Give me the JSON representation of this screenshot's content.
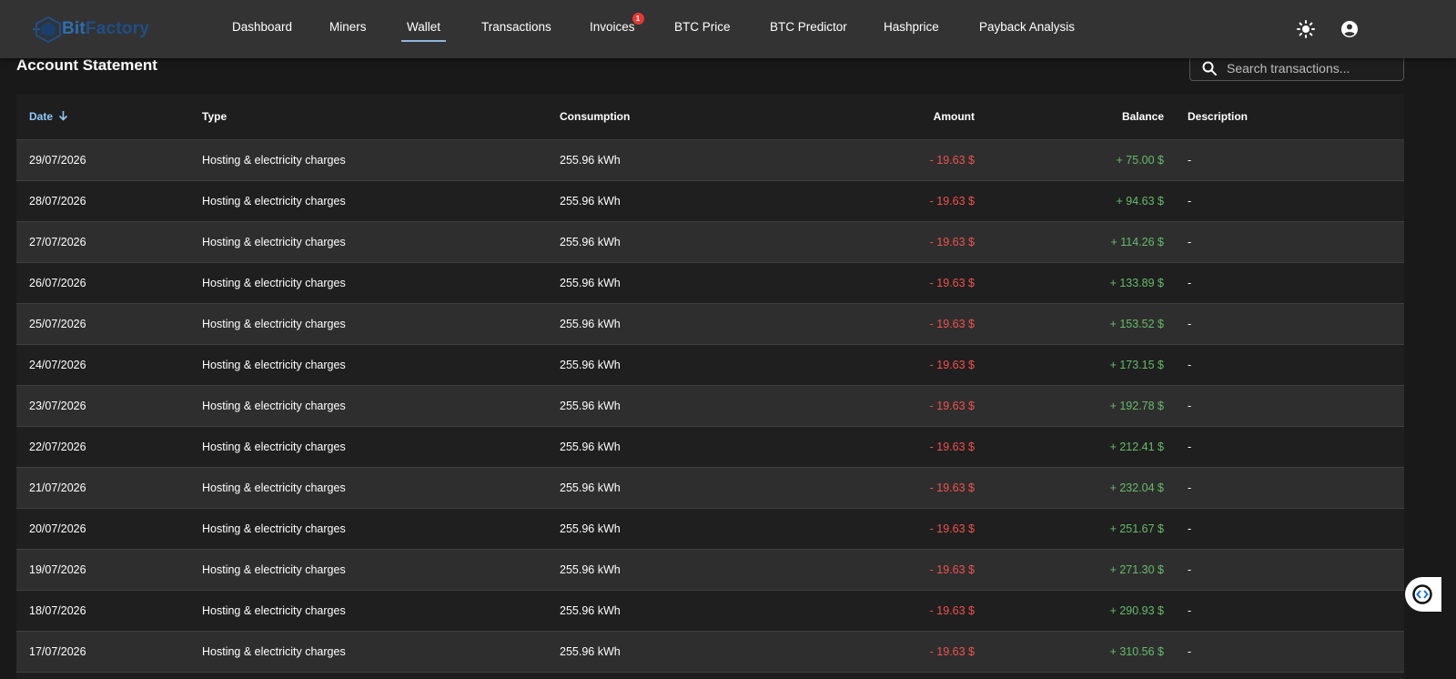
{
  "app": {
    "logo_text_a": "Bit",
    "logo_text_b": "Factory"
  },
  "nav": {
    "items": [
      {
        "label": "Dashboard"
      },
      {
        "label": "Miners"
      },
      {
        "label": "Wallet"
      },
      {
        "label": "Transactions"
      },
      {
        "label": "Invoices",
        "badge": "1"
      },
      {
        "label": "BTC Price"
      },
      {
        "label": "BTC Predictor"
      },
      {
        "label": "Hashprice"
      },
      {
        "label": "Payback Analysis"
      }
    ],
    "active": "Wallet",
    "icons": [
      "theme-toggle-sun-icon",
      "account-circle-icon"
    ]
  },
  "page": {
    "title": "Account Statement",
    "search_placeholder": "Search transactions..."
  },
  "table": {
    "columns": [
      "Date",
      "Type",
      "Consumption",
      "Amount",
      "Balance",
      "Description"
    ],
    "sort_column": "Date",
    "sort_direction": "descending",
    "rows": [
      {
        "date": "29/07/2026",
        "type": "Hosting & electricity charges",
        "consumption": "255.96 kWh",
        "amount": "- 19.63 $",
        "balance": "+ 75.00 $",
        "description": "-"
      },
      {
        "date": "28/07/2026",
        "type": "Hosting & electricity charges",
        "consumption": "255.96 kWh",
        "amount": "- 19.63 $",
        "balance": "+ 94.63 $",
        "description": "-"
      },
      {
        "date": "27/07/2026",
        "type": "Hosting & electricity charges",
        "consumption": "255.96 kWh",
        "amount": "- 19.63 $",
        "balance": "+ 114.26 $",
        "description": "-"
      },
      {
        "date": "26/07/2026",
        "type": "Hosting & electricity charges",
        "consumption": "255.96 kWh",
        "amount": "- 19.63 $",
        "balance": "+ 133.89 $",
        "description": "-"
      },
      {
        "date": "25/07/2026",
        "type": "Hosting & electricity charges",
        "consumption": "255.96 kWh",
        "amount": "- 19.63 $",
        "balance": "+ 153.52 $",
        "description": "-"
      },
      {
        "date": "24/07/2026",
        "type": "Hosting & electricity charges",
        "consumption": "255.96 kWh",
        "amount": "- 19.63 $",
        "balance": "+ 173.15 $",
        "description": "-"
      },
      {
        "date": "23/07/2026",
        "type": "Hosting & electricity charges",
        "consumption": "255.96 kWh",
        "amount": "- 19.63 $",
        "balance": "+ 192.78 $",
        "description": "-"
      },
      {
        "date": "22/07/2026",
        "type": "Hosting & electricity charges",
        "consumption": "255.96 kWh",
        "amount": "- 19.63 $",
        "balance": "+ 212.41 $",
        "description": "-"
      },
      {
        "date": "21/07/2026",
        "type": "Hosting & electricity charges",
        "consumption": "255.96 kWh",
        "amount": "- 19.63 $",
        "balance": "+ 232.04 $",
        "description": "-"
      },
      {
        "date": "20/07/2026",
        "type": "Hosting & electricity charges",
        "consumption": "255.96 kWh",
        "amount": "- 19.63 $",
        "balance": "+ 251.67 $",
        "description": "-"
      },
      {
        "date": "19/07/2026",
        "type": "Hosting & electricity charges",
        "consumption": "255.96 kWh",
        "amount": "- 19.63 $",
        "balance": "+ 271.30 $",
        "description": "-"
      },
      {
        "date": "18/07/2026",
        "type": "Hosting & electricity charges",
        "consumption": "255.96 kWh",
        "amount": "- 19.63 $",
        "balance": "+ 290.93 $",
        "description": "-"
      },
      {
        "date": "17/07/2026",
        "type": "Hosting & electricity charges",
        "consumption": "255.96 kWh",
        "amount": "- 19.63 $",
        "balance": "+ 310.56 $",
        "description": "-"
      }
    ]
  },
  "colors": {
    "negative": "#f0524d",
    "positive": "#66bb6a",
    "accent": "#90caf9",
    "badge": "#e53935"
  }
}
